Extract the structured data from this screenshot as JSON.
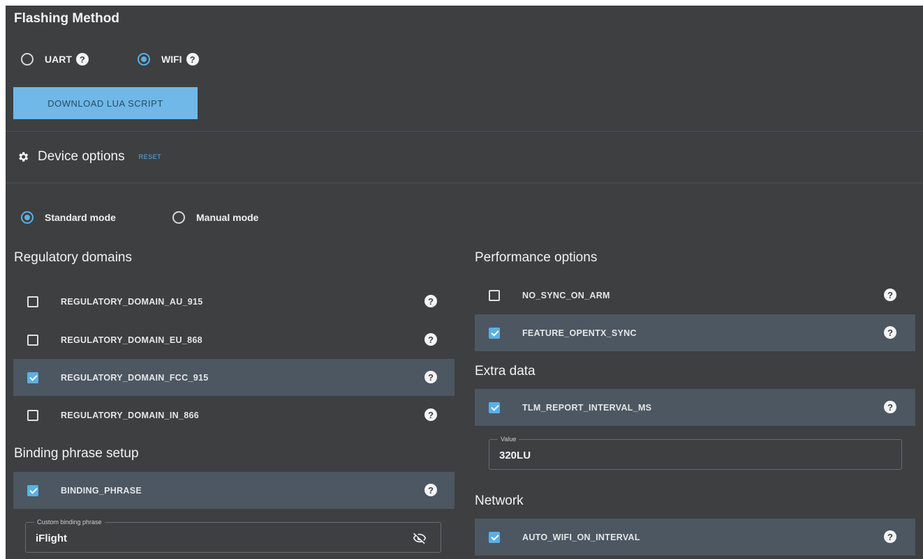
{
  "flashing": {
    "title": "Flashing Method",
    "methods": [
      {
        "label": "UART",
        "selected": false
      },
      {
        "label": "WIFI",
        "selected": true
      }
    ],
    "download_label": "DOWNLOAD LUA SCRIPT"
  },
  "device_options": {
    "title": "Device options",
    "reset_label": "RESET",
    "modes": [
      {
        "label": "Standard mode",
        "selected": true
      },
      {
        "label": "Manual mode",
        "selected": false
      }
    ]
  },
  "regulatory": {
    "title": "Regulatory domains",
    "items": [
      {
        "label": "REGULATORY_DOMAIN_AU_915",
        "checked": false
      },
      {
        "label": "REGULATORY_DOMAIN_EU_868",
        "checked": false
      },
      {
        "label": "REGULATORY_DOMAIN_FCC_915",
        "checked": true
      },
      {
        "label": "REGULATORY_DOMAIN_IN_866",
        "checked": false
      }
    ]
  },
  "binding": {
    "title": "Binding phrase setup",
    "item": {
      "label": "BINDING_PHRASE",
      "checked": true
    },
    "field_label": "Custom binding phrase",
    "field_value": "iFlight"
  },
  "performance": {
    "title": "Performance options",
    "items": [
      {
        "label": "NO_SYNC_ON_ARM",
        "checked": false
      },
      {
        "label": "FEATURE_OPENTX_SYNC",
        "checked": true
      }
    ]
  },
  "extra": {
    "title": "Extra data",
    "item": {
      "label": "TLM_REPORT_INTERVAL_MS",
      "checked": true
    },
    "field_label": "Value",
    "field_value": "320LU"
  },
  "network": {
    "title": "Network",
    "item": {
      "label": "AUTO_WIFI_ON_INTERVAL",
      "checked": true
    }
  },
  "icons": {
    "help": "help-circle-icon",
    "gear": "gear-icon",
    "visibility_off": "eye-off-icon"
  },
  "colors": {
    "background": "#3e3f41",
    "selected_row": "#4c5762",
    "accent": "#5ab0e6",
    "button": "#6fb8e8"
  }
}
